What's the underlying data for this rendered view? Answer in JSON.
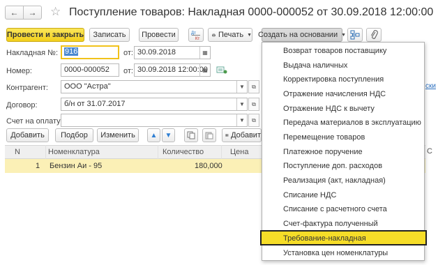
{
  "window": {
    "nav_back": "←",
    "nav_forward": "→",
    "title": "Поступление товаров: Накладная 0000-000052 от 30.09.2018 12:00:00"
  },
  "toolbar": {
    "post_close": "Провести и закрыть",
    "save": "Записать",
    "post": "Провести",
    "dt_kt_top": "Дт",
    "dt_kt_bottom": "Кт",
    "print": "Печать",
    "create_based": "Создать на основании"
  },
  "form": {
    "invoice_label": "Накладная №:",
    "invoice_value": "916",
    "from_label": "от:",
    "invoice_date": "30.09.2018",
    "number_label": "Номер:",
    "number_value": "0000-000052",
    "number_date": "30.09.2018 12:00:00",
    "counterparty_label": "Контрагент:",
    "counterparty_value": "ООО \"Астра\"",
    "contract_label": "Договор:",
    "contract_value": "б/н от 31.07.2017",
    "payment_invoice_label": "Счет на оплату:",
    "payment_invoice_value": ""
  },
  "table_toolbar": {
    "add": "Добавить",
    "select": "Подбор",
    "change": "Изменить",
    "add_right": "Добавит"
  },
  "table": {
    "columns": [
      "N",
      "Номенклатура",
      "Количество",
      "Цена"
    ],
    "rows": [
      {
        "n": "1",
        "item": "Бензин Аи - 95",
        "qty": "180,000",
        "price": ""
      }
    ]
  },
  "peek": {
    "link_fragment": "ски",
    "column_fragment": "С"
  },
  "dropdown_menu": {
    "items": [
      "Возврат товаров поставщику",
      "Выдача наличных",
      "Корректировка поступления",
      "Отражение начисления НДС",
      "Отражение НДС к вычету",
      "Передача материалов в эксплуатацию",
      "Перемещение товаров",
      "Платежное поручение",
      "Поступление доп. расходов",
      "Реализация (акт, накладная)",
      "Списание НДС",
      "Списание с расчетного счета",
      "Счет-фактура полученный",
      "Требование-накладная",
      "Установка цен номенклатуры"
    ],
    "highlighted": "Требование-накладная"
  },
  "colors": {
    "accent_yellow": "#f2cf1c",
    "highlight_yellow": "#f6dd28",
    "row_selected": "#fbf0b6",
    "text_selection": "#4a88d0",
    "link_blue": "#2b6fbf"
  }
}
